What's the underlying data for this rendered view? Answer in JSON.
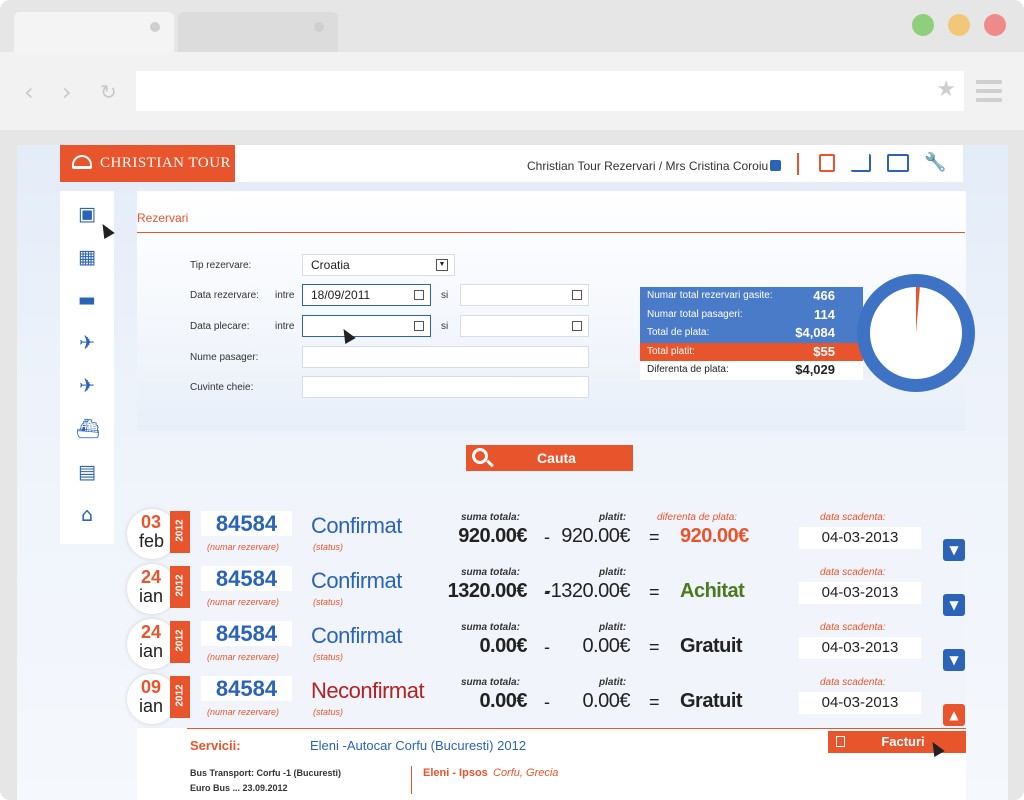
{
  "browser": {
    "url": ""
  },
  "header": {
    "brand": "CHRISTIAN TOUR",
    "user_line": "Christian Tour Rezervari / Mrs Cristina Coroiu"
  },
  "sidebar": {
    "items": [
      "package-icon",
      "map-icon",
      "hotel-bed-icon",
      "flight-hotel-icon",
      "plane-icon",
      "ship-icon",
      "bus-icon",
      "home-icon"
    ]
  },
  "search": {
    "title": "Rezervari",
    "tip_label": "Tip rezervare:",
    "tip_value": "Croatia",
    "data_rez_label": "Data rezervare:",
    "data_plecare_label": "Data plecare:",
    "intre": "intre",
    "si": "si",
    "data_rez_from": "18/09/2011",
    "nume_label": "Nume pasager:",
    "cuvinte_label": "Cuvinte cheie:",
    "button": "Cauta"
  },
  "stats": {
    "rows": [
      {
        "label": "Numar total rezervari gasite:",
        "value": "466"
      },
      {
        "label": "Numar total pasageri:",
        "value": "114"
      },
      {
        "label": "Total de plata:",
        "value": "$4,084"
      },
      {
        "label": "Total platit:",
        "value": "$55"
      },
      {
        "label": "Diferenta de plata:",
        "value": "$4,029"
      }
    ],
    "pie_paid_fraction": 0.0135,
    "colors": {
      "blue": "#4a7bc8",
      "orange": "#e8542c"
    }
  },
  "labels": {
    "numar_rezervare": "(numar rezervare)",
    "status": "(status)",
    "suma_totala": "suma totala:",
    "platit": "platit:",
    "diferenta": "diferenta de plata:",
    "data_scadenta": "data scadenta:",
    "minus": "-",
    "equals": "="
  },
  "reservations": [
    {
      "day": "03",
      "month": "feb",
      "year": "2012",
      "number": "84584",
      "status": "Confirmat",
      "total": "920.00€",
      "paid": "920.00€",
      "result": "920.00€",
      "due": "04-03-2013"
    },
    {
      "day": "24",
      "month": "ian",
      "year": "2012",
      "number": "84584",
      "status": "Confirmat",
      "total": "1320.00€",
      "paid": "-1320.00€",
      "result": "Achitat",
      "due": "04-03-2013"
    },
    {
      "day": "24",
      "month": "ian",
      "year": "2012",
      "number": "84584",
      "status": "Confirmat",
      "total": "0.00€",
      "paid": "0.00€",
      "result": "Gratuit",
      "due": "04-03-2013"
    },
    {
      "day": "09",
      "month": "ian",
      "year": "2012",
      "number": "84584",
      "status": "Neconfirmat",
      "total": "0.00€",
      "paid": "0.00€",
      "result": "Gratuit",
      "due": "04-03-2013"
    }
  ],
  "detail": {
    "services_label": "Servicii:",
    "services_value": "Eleni -Autocar Corfu (Bucuresti) 2012",
    "facturi": "Facturi",
    "bus": "Bus Transport: Corfu -1 (Bucuresti)",
    "bus2": "Euro Bus ...  23.09.2012",
    "hotel": "Eleni - Ipsos",
    "hotel_loc": "Corfu, Grecia"
  }
}
